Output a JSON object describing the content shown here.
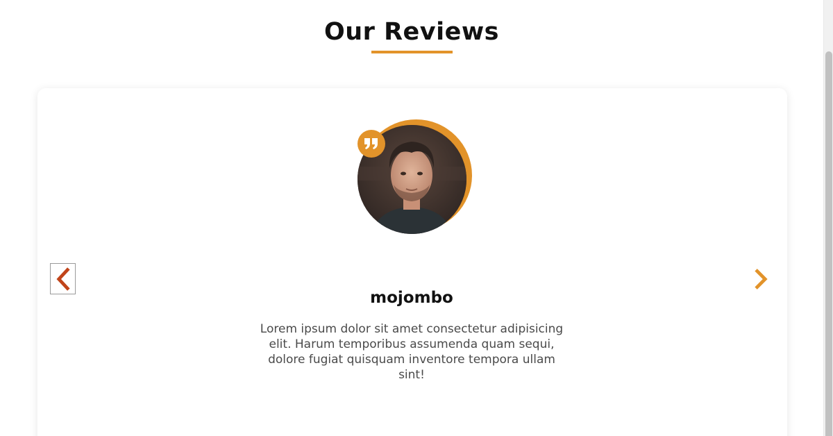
{
  "section": {
    "title": "Our Reviews"
  },
  "review": {
    "name": "mojombo",
    "text": "Lorem ipsum dolor sit amet consectetur adipisicing elit. Harum temporibus assumenda quam sequi, dolore fugiat quisquam inventore tempora ullam sint!",
    "avatar_alt": "mojombo avatar"
  },
  "navigation": {
    "prev_icon": "chevron-left-icon",
    "next_icon": "chevron-right-icon",
    "prev_label": "Previous review",
    "next_label": "Next review"
  },
  "colors": {
    "accent": "#e2932a",
    "prev_arrow": "#c1441a",
    "next_arrow": "#e2932a",
    "heading": "#111111",
    "body_text": "#4a4a4a"
  },
  "icons": {
    "quote_badge": "quote-icon"
  }
}
